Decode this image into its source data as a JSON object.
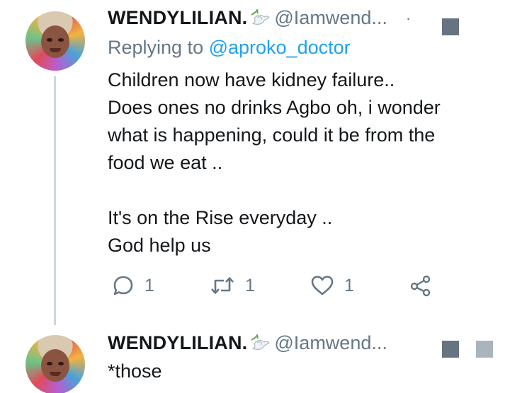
{
  "tweets": [
    {
      "display_name": "WENDYLILIAN.",
      "name_emoji_icon": "dove-with-olive-branch-icon",
      "handle": "@Iamwend...",
      "dot": "·",
      "replying_prefix": "Replying to ",
      "replying_mention": "@aproko_doctor",
      "text": "Children now have kidney failure..\nDoes ones no drinks Agbo oh, i wonder\nwhat is happening, could it be from the\nfood we eat ..\n\nIt's on the Rise everyday ..\nGod help us",
      "actions": {
        "reply_count": "1",
        "retweet_count": "1",
        "like_count": "1"
      }
    },
    {
      "display_name": "WENDYLILIAN.",
      "name_emoji_icon": "dove-with-olive-branch-icon",
      "handle": "@Iamwend...",
      "text": "*those"
    }
  ],
  "colors": {
    "text": "#14171a",
    "secondary": "#657786",
    "link": "#1da1f2",
    "thread_line": "#ccd6dd"
  }
}
